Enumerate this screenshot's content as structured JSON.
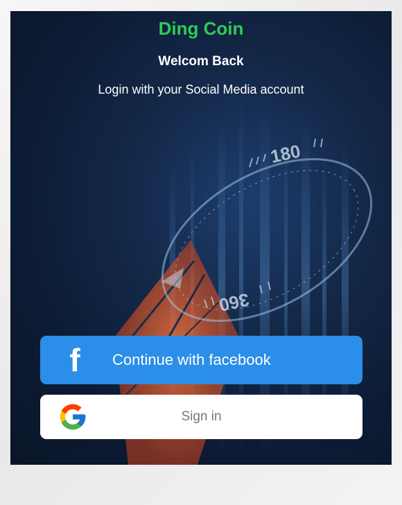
{
  "app": {
    "title": "Ding Coin",
    "greeting": "Welcom Back",
    "instruction": "Login with your Social Media account"
  },
  "background": {
    "dial_labels": [
      "180",
      "360"
    ]
  },
  "buttons": {
    "facebook": {
      "icon": "facebook-f-icon",
      "label": "Continue with facebook"
    },
    "google": {
      "icon": "google-g-icon",
      "label": "Sign in"
    }
  },
  "colors": {
    "title": "#2ecc55",
    "facebook_button": "#2b8ee8",
    "google_button": "#ffffff",
    "background": "#132746"
  }
}
